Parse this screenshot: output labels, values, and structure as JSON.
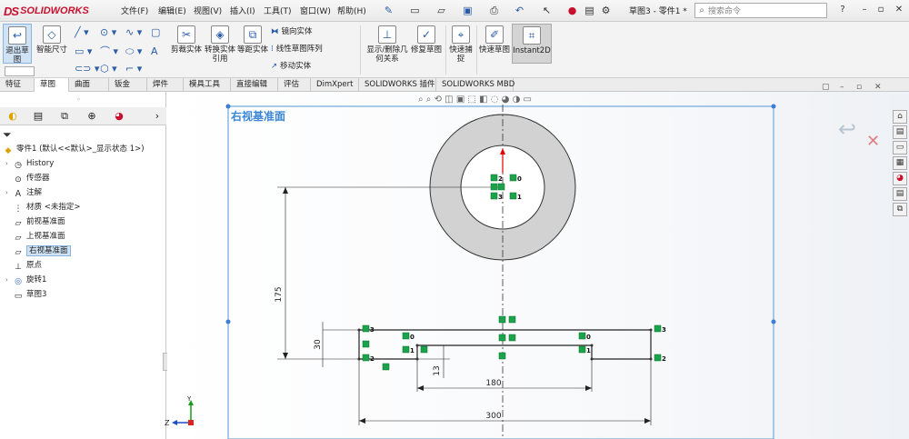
{
  "app": {
    "logo_text": "SOLIDWORKS",
    "logo_mark": "DS",
    "menus": [
      "文件(F)",
      "编辑(E)",
      "视图(V)",
      "插入(I)",
      "工具(T)",
      "窗口(W)",
      "帮助(H)"
    ],
    "doc_title": "草图3 - 零件1 *",
    "search_placeholder": "搜索命令",
    "brand_color": "#c8102e",
    "accent_color": "#2a5ca8"
  },
  "ribbon": {
    "exit_sketch": "退出草图",
    "smart_dim": "智能尺寸",
    "trim": "剪裁实体",
    "convert": "转换实体引用",
    "offset": "等距实体",
    "mirror": "镜向实体",
    "linear_pattern": "线性草图阵列",
    "move": "移动实体",
    "relations": "显示/删除几何关系",
    "repair": "修复草图",
    "snap": "快速捕捉",
    "rapid_sketch": "快速草图",
    "instant2d": "Instant2D"
  },
  "tabs": [
    "特征",
    "草图",
    "曲面",
    "钣金",
    "焊件",
    "模具工具",
    "直接编辑",
    "评估",
    "DimXpert",
    "SOLIDWORKS 插件",
    "SOLIDWORKS MBD"
  ],
  "active_tab": "草图",
  "tree": {
    "root": "零件1 (默认<<默认>_显示状态 1>)",
    "items": [
      {
        "label": "History",
        "icon": "history-icon",
        "expand": true
      },
      {
        "label": "传感器",
        "icon": "sensor-icon",
        "expand": false
      },
      {
        "label": "注解",
        "icon": "annotation-icon",
        "expand": true
      },
      {
        "label": "材质 <未指定>",
        "icon": "material-icon",
        "expand": false
      },
      {
        "label": "前视基准面",
        "icon": "plane-icon",
        "expand": false
      },
      {
        "label": "上视基准面",
        "icon": "plane-icon",
        "expand": false
      },
      {
        "label": "右视基准面",
        "icon": "plane-icon",
        "expand": false,
        "selected": true
      },
      {
        "label": "原点",
        "icon": "origin-icon",
        "expand": false
      },
      {
        "label": "旋转1",
        "icon": "revolve-icon",
        "expand": true
      },
      {
        "label": "草图3",
        "icon": "sketch-icon",
        "expand": false
      }
    ]
  },
  "canvas": {
    "plane_label": "右视基准面",
    "dims": {
      "d175": "175",
      "d30": "30",
      "d13": "13",
      "d180": "180",
      "d300": "300"
    },
    "relation_nums": [
      "0",
      "1",
      "2",
      "3"
    ],
    "triad": {
      "z": "Z",
      "x": "X",
      "y": "Y"
    }
  }
}
